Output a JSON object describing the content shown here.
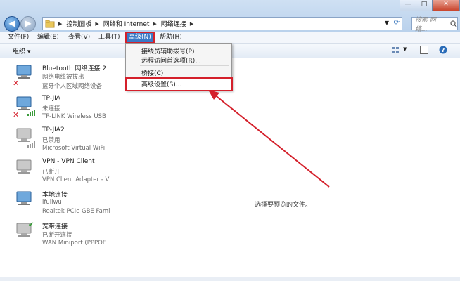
{
  "window": {
    "breadcrumb": [
      "控制面板",
      "网络和 Internet",
      "网络连接"
    ],
    "search_placeholder": "搜索 网络...",
    "back_symbol": "◀",
    "forward_symbol": "▶",
    "minimize": "—",
    "maximize": "□",
    "close": "✕"
  },
  "menu": {
    "file": "文件(F)",
    "edit": "编辑(E)",
    "view": "查看(V)",
    "tools": "工具(T)",
    "advanced": "高级(N)",
    "help": "帮助(H)"
  },
  "toolbar": {
    "organize": "组织 ▾"
  },
  "dropdown": {
    "operator_dial": "接线员辅助拨号(P)",
    "remote_access": "远程访问首选项(R)...",
    "bridge": "桥接(C)",
    "advanced_settings": "高级设置(S)..."
  },
  "connections": [
    {
      "name": "Bluetooth 网络连接 2",
      "status": "网络电缆被拔出",
      "device": "蓝牙个人区域网络设备",
      "mark": "✕",
      "mark_color": "#d4202b"
    },
    {
      "name": "TP-JIA",
      "status": "未连接",
      "device": "TP-LINK Wireless USB",
      "mark": "✕",
      "mark_color": "#d4202b"
    },
    {
      "name": "TP-JIA2",
      "status": "已禁用",
      "device": "Microsoft Virtual WiFi",
      "mark": "",
      "mark_color": "#888888"
    },
    {
      "name": "VPN - VPN Client",
      "status": "已断开",
      "device": "VPN Client Adapter - V",
      "mark": "",
      "mark_color": "#888888"
    },
    {
      "name": "本地连接",
      "status": "ifuliwu",
      "device": "Realtek PCIe GBE Fami",
      "mark": "",
      "mark_color": "#888888"
    },
    {
      "name": "宽带连接",
      "status": "已断开连接",
      "device": "WAN Miniport (PPPOE",
      "mark": "✔",
      "mark_color": "#2e9a2e"
    }
  ],
  "preview_text": "选择要预览的文件。",
  "colors": {
    "highlight": "#3a79c6",
    "annotation_red": "#d4202b"
  }
}
